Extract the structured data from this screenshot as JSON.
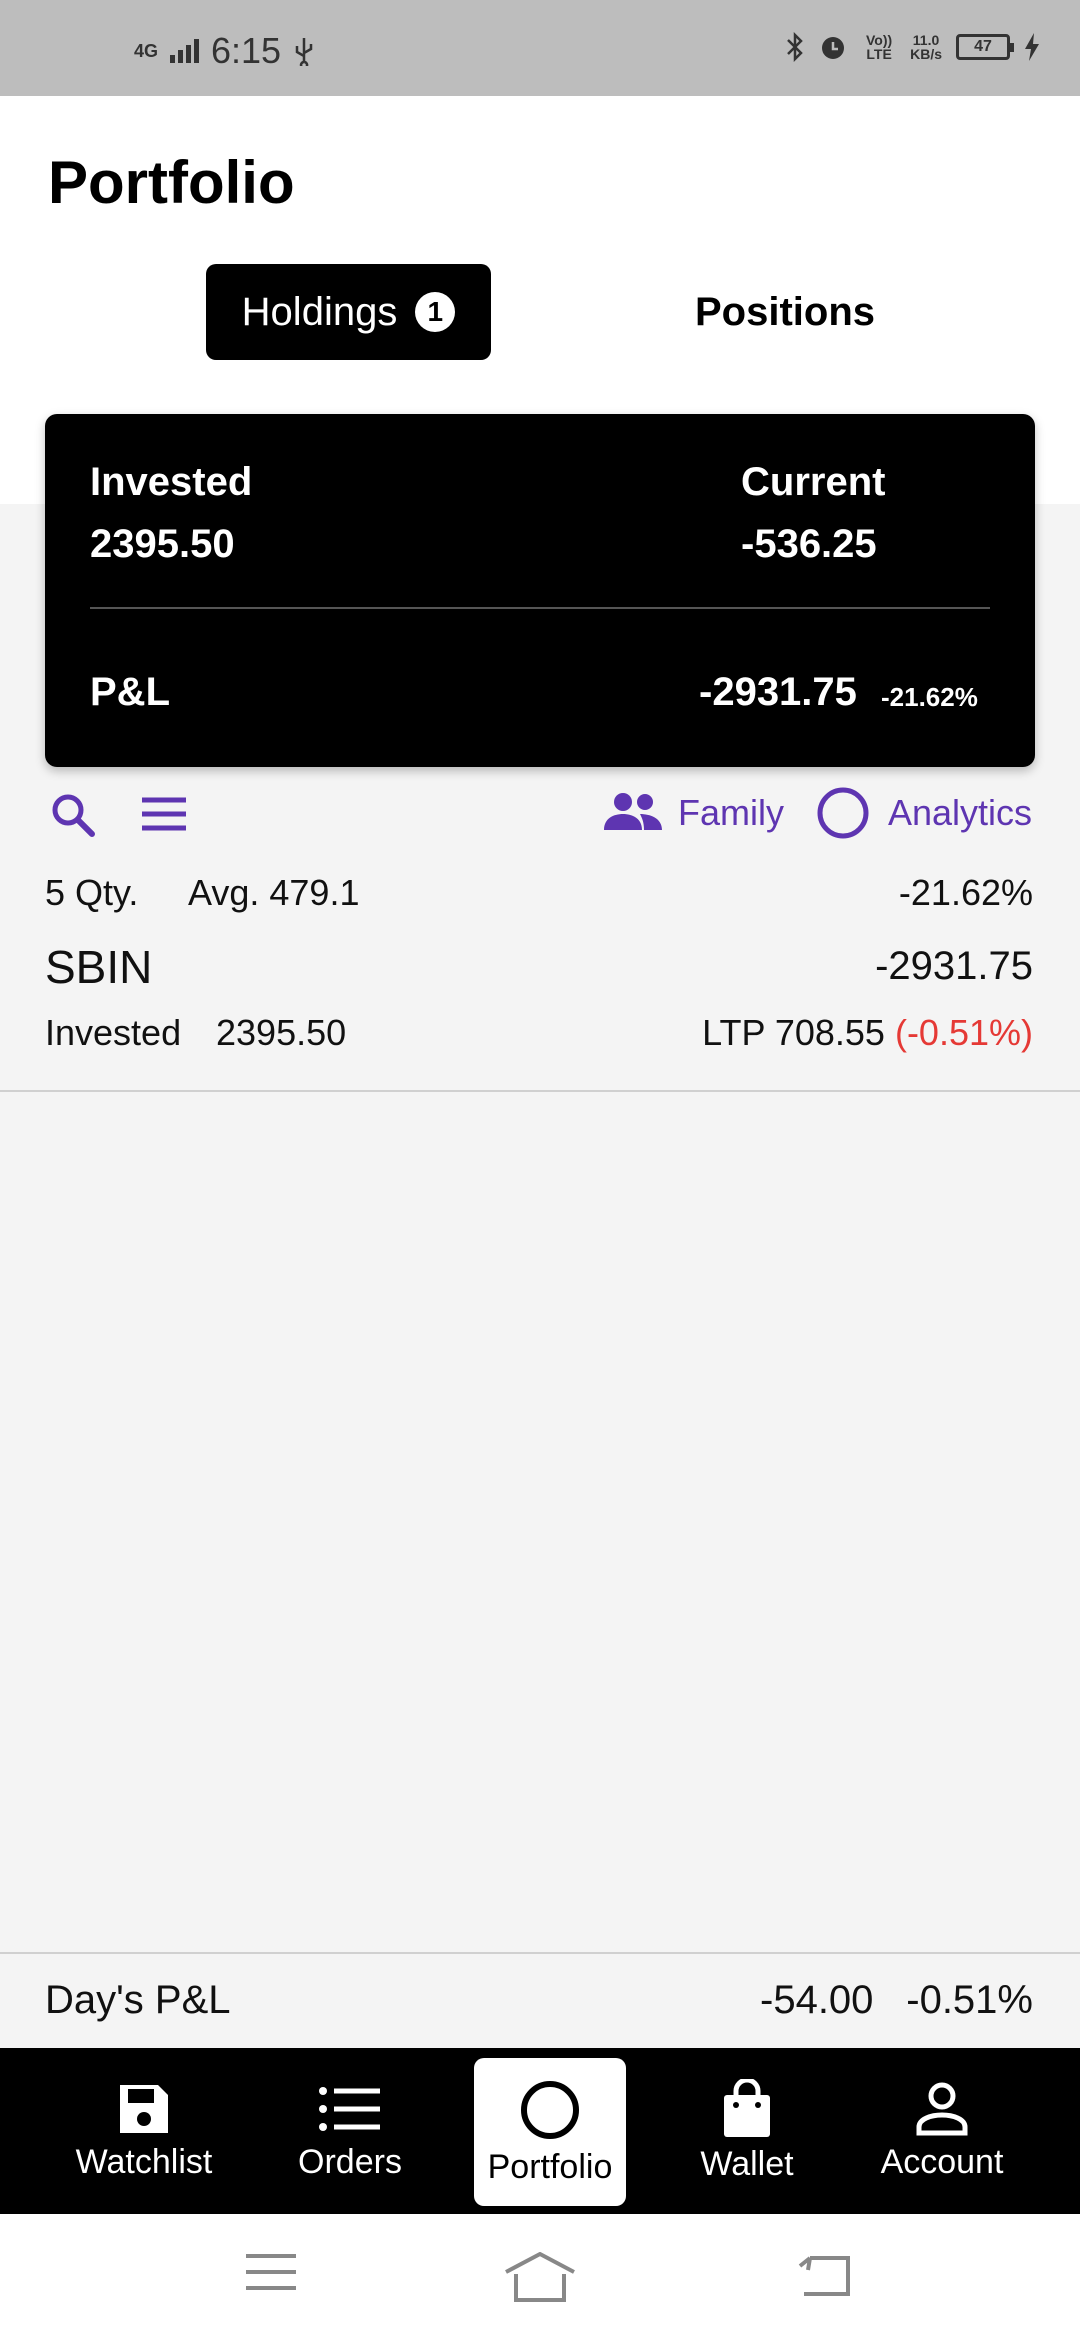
{
  "status_bar": {
    "network": "4G",
    "time": "6:15",
    "volte": "Vo)) LTE",
    "speed": "11.0",
    "speed_unit": "KB/s",
    "battery": "47"
  },
  "header": {
    "title": "Portfolio",
    "tabs": [
      {
        "label": "Holdings",
        "badge": "1",
        "active": true
      },
      {
        "label": "Positions",
        "active": false
      }
    ]
  },
  "summary": {
    "invested_label": "Invested",
    "invested_value": "2395.50",
    "current_label": "Current",
    "current_value": "-536.25",
    "pl_label": "P&L",
    "pl_value": "-2931.75",
    "pl_percent": "-21.62%"
  },
  "toolbar": {
    "family_label": "Family",
    "analytics_label": "Analytics",
    "accent_color": "#5e35b1"
  },
  "holdings": [
    {
      "qty": "5 Qty.",
      "avg": "Avg. 479.1",
      "pct": "-21.62%",
      "symbol": "SBIN",
      "pl": "-2931.75",
      "invested_label": "Invested",
      "invested_value": "2395.50",
      "ltp": "LTP 708.55",
      "change": "(-0.51%)"
    }
  ],
  "day_pl": {
    "label": "Day's P&L",
    "value": "-54.00",
    "percent": "-0.51%"
  },
  "bottom_nav": [
    {
      "label": "Watchlist",
      "icon": "save-icon"
    },
    {
      "label": "Orders",
      "icon": "list-icon"
    },
    {
      "label": "Portfolio",
      "icon": "circle-icon",
      "active": true
    },
    {
      "label": "Wallet",
      "icon": "bag-icon"
    },
    {
      "label": "Account",
      "icon": "person-icon"
    }
  ]
}
